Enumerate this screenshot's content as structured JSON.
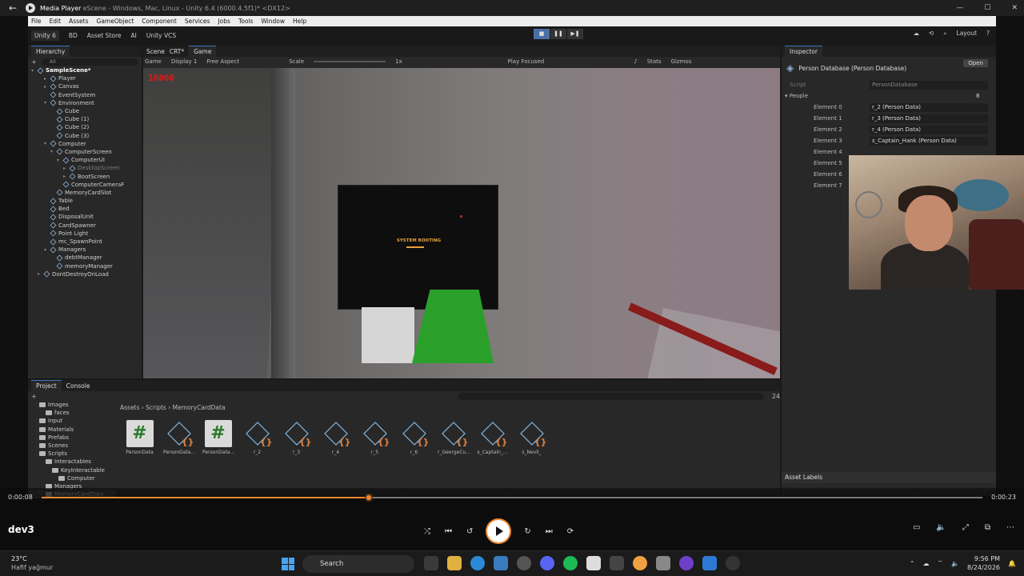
{
  "media_player": {
    "title": "Media Player",
    "title_behind": "eScene - Windows, Mac, Linux - Unity 6.4 (6000.4.5f1)* <DX12>",
    "current_time": "0:00:08",
    "total_time": "0:00:23",
    "progress": 0.348,
    "track_name": "dev3"
  },
  "unity": {
    "menu": [
      "File",
      "Edit",
      "Assets",
      "GameObject",
      "Component",
      "Services",
      "Jobs",
      "Tools",
      "Window",
      "Help"
    ],
    "toolbar": {
      "version": "Unity 6",
      "account": "BD",
      "asset_store": "Asset Store",
      "ai": "AI",
      "vcs": "Unity VCS",
      "layout": "Layout"
    },
    "hierarchy": {
      "tab": "Hierarchy",
      "search": "All",
      "items": [
        {
          "label": "SampleScene*",
          "indent": 0,
          "style": "bold",
          "arrow": "▾"
        },
        {
          "label": "Player",
          "indent": 2,
          "arrow": "▸"
        },
        {
          "label": "Canvas",
          "indent": 2,
          "arrow": "▸"
        },
        {
          "label": "EventSystem",
          "indent": 2,
          "arrow": ""
        },
        {
          "label": "Environment",
          "indent": 2,
          "arrow": "▾"
        },
        {
          "label": "Cube",
          "indent": 3,
          "arrow": ""
        },
        {
          "label": "Cube (1)",
          "indent": 3,
          "arrow": ""
        },
        {
          "label": "Cube (2)",
          "indent": 3,
          "arrow": ""
        },
        {
          "label": "Cube (3)",
          "indent": 3,
          "arrow": ""
        },
        {
          "label": "Computer",
          "indent": 2,
          "arrow": "▾"
        },
        {
          "label": "ComputerScreen",
          "indent": 3,
          "arrow": "▾"
        },
        {
          "label": "ComputerUI",
          "indent": 4,
          "arrow": "▾"
        },
        {
          "label": "DesktopScreen",
          "indent": 5,
          "arrow": "▸",
          "style": "dim"
        },
        {
          "label": "BootScreen",
          "indent": 5,
          "arrow": "▸"
        },
        {
          "label": "ComputerCameraF",
          "indent": 4,
          "arrow": ""
        },
        {
          "label": "MemoryCardSlot",
          "indent": 3,
          "arrow": ""
        },
        {
          "label": "Table",
          "indent": 2,
          "arrow": ""
        },
        {
          "label": "Bed",
          "indent": 2,
          "arrow": ""
        },
        {
          "label": "DisposalUnit",
          "indent": 2,
          "arrow": ""
        },
        {
          "label": "CardSpawner",
          "indent": 2,
          "arrow": ""
        },
        {
          "label": "Point Light",
          "indent": 2,
          "arrow": ""
        },
        {
          "label": "mc_SpawnPoint",
          "indent": 2,
          "arrow": ""
        },
        {
          "label": "Managers",
          "indent": 2,
          "arrow": "▾"
        },
        {
          "label": "debtManager",
          "indent": 3,
          "arrow": ""
        },
        {
          "label": "memoryManager",
          "indent": 3,
          "arrow": ""
        },
        {
          "label": "DontDestroyOnLoad",
          "indent": 1,
          "arrow": "▸"
        }
      ]
    },
    "tabs": {
      "scene": "Scene",
      "crt": "CRT*",
      "game": "Game"
    },
    "game_bar": {
      "view": "Game",
      "display": "Display 1",
      "aspect": "Free Aspect",
      "scale_label": "Scale",
      "scale_value": "1x",
      "focus": "Play Focused",
      "stats": "Stats",
      "gizmos": "Gizmos"
    },
    "game_view": {
      "money": "10000",
      "boot_text": "SYSTEM BOOTING"
    },
    "inspector": {
      "tab": "Inspector",
      "title": "Person Database (Person Database)",
      "open_label": "Open",
      "script_label": "Script",
      "script_value": "PersonDatabase",
      "people_label": "People",
      "people_count": "8",
      "elements": [
        {
          "label": "Element 0",
          "value": "r_2 (Person Data)"
        },
        {
          "label": "Element 1",
          "value": "r_3 (Person Data)"
        },
        {
          "label": "Element 2",
          "value": "r_4 (Person Data)"
        },
        {
          "label": "Element 3",
          "value": "s_Captain_Hank (Person Data)"
        },
        {
          "label": "Element 4",
          "value": ""
        },
        {
          "label": "Element 5",
          "value": ""
        },
        {
          "label": "Element 6",
          "value": ""
        },
        {
          "label": "Element 7",
          "value": ""
        }
      ],
      "asset_labels": "Asset Labels"
    },
    "project": {
      "tab_project": "Project",
      "tab_console": "Console",
      "breadcrumb": "Assets  ›  Scripts  ›  MemoryCardData",
      "count": "24",
      "tree": [
        {
          "label": "Images",
          "indent": 1
        },
        {
          "label": "faces",
          "indent": 2
        },
        {
          "label": "Input",
          "indent": 1
        },
        {
          "label": "Materials",
          "indent": 1
        },
        {
          "label": "Prefabs",
          "indent": 1
        },
        {
          "label": "Scenes",
          "indent": 1
        },
        {
          "label": "Scripts",
          "indent": 1
        },
        {
          "label": "Interactables",
          "indent": 2
        },
        {
          "label": "KeyInteractable",
          "indent": 3
        },
        {
          "label": "Computer",
          "indent": 4
        },
        {
          "label": "Managers",
          "indent": 2
        },
        {
          "label": "MemoryCardData",
          "indent": 2
        }
      ],
      "assets": [
        {
          "label": "PersonData",
          "kind": "script"
        },
        {
          "label": "PersonData...",
          "kind": "cube"
        },
        {
          "label": "PersonData...",
          "kind": "script"
        },
        {
          "label": "r_2",
          "kind": "cube"
        },
        {
          "label": "r_3",
          "kind": "cube"
        },
        {
          "label": "r_4",
          "kind": "cube"
        },
        {
          "label": "r_5",
          "kind": "cube"
        },
        {
          "label": "r_6",
          "kind": "cube"
        },
        {
          "label": "r_GeorgeCu...",
          "kind": "cube"
        },
        {
          "label": "s_Captain_...",
          "kind": "cube"
        },
        {
          "label": "s_Nevil_",
          "kind": "cube"
        }
      ]
    }
  },
  "taskbar": {
    "weather_temp": "23°C",
    "weather_desc": "Hafif yağmur",
    "search_label": "Search",
    "time": "9:56 PM",
    "date": "8/24/2026",
    "accent": "#f08a2e"
  }
}
